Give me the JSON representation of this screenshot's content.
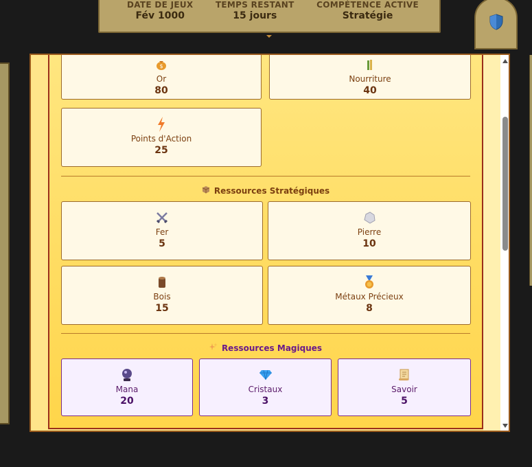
{
  "topbar": {
    "stats": [
      {
        "label": "DATE DE JEUX",
        "value": "Fév 1000"
      },
      {
        "label": "TEMPS RESTANT",
        "value": "15 jours"
      },
      {
        "label": "COMPÉTENCE ACTIVE",
        "value": "Stratégie"
      }
    ]
  },
  "basic": [
    {
      "name": "Or",
      "value": "80",
      "icon": "money-bag-icon"
    },
    {
      "name": "Nourriture",
      "value": "40",
      "icon": "wheat-icon"
    },
    {
      "name": "Points d'Action",
      "value": "25",
      "icon": "lightning-icon"
    }
  ],
  "strategic": {
    "title": "Ressources Stratégiques",
    "icon": "package-icon",
    "items": [
      {
        "name": "Fer",
        "value": "5",
        "icon": "crossed-swords-icon"
      },
      {
        "name": "Pierre",
        "value": "10",
        "icon": "rock-icon"
      },
      {
        "name": "Bois",
        "value": "15",
        "icon": "wood-icon"
      },
      {
        "name": "Métaux Précieux",
        "value": "8",
        "icon": "medal-icon"
      }
    ]
  },
  "magic": {
    "title": "Ressources Magiques",
    "icon": "sparkles-icon",
    "items": [
      {
        "name": "Mana",
        "value": "20",
        "icon": "crystal-ball-icon"
      },
      {
        "name": "Cristaux",
        "value": "3",
        "icon": "gem-icon"
      },
      {
        "name": "Savoir",
        "value": "5",
        "icon": "scroll-icon"
      }
    ]
  }
}
